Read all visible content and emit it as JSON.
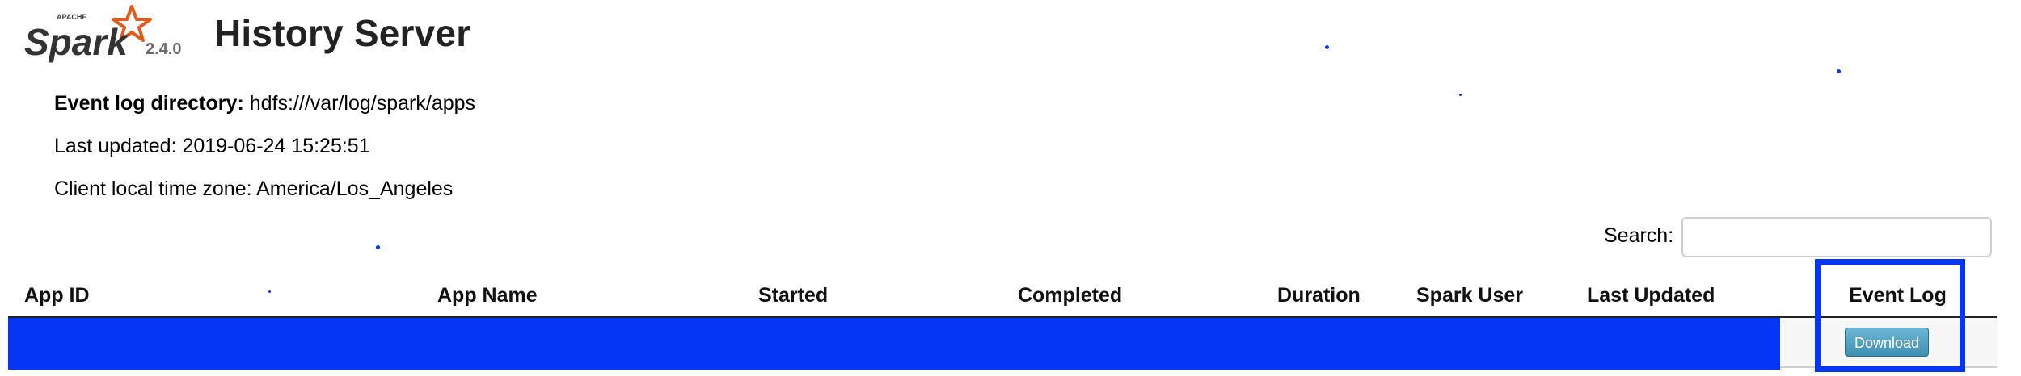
{
  "app": {
    "logo_text": "Spark",
    "logo_small": "APACHE",
    "version": "2.4.0",
    "title": "History Server"
  },
  "info": {
    "event_log_dir_label": "Event log directory:",
    "event_log_dir_value": "hdfs:///var/log/spark/apps",
    "last_updated": "Last updated: 2019-06-24 15:25:51",
    "timezone": "Client local time zone: America/Los_Angeles"
  },
  "search": {
    "label": "Search:",
    "value": "",
    "placeholder": ""
  },
  "table": {
    "headers": [
      "App ID",
      "App Name",
      "Started",
      "Completed",
      "Duration",
      "Spark User",
      "Last Updated",
      "Event Log"
    ],
    "rows": [
      {
        "download_label": "Download"
      }
    ]
  },
  "colors": {
    "redaction": "#0535f5",
    "logo_orange": "#e25a1c",
    "button": "#4a9cc0"
  },
  "icons": {
    "logo": "spark-star-logo"
  }
}
